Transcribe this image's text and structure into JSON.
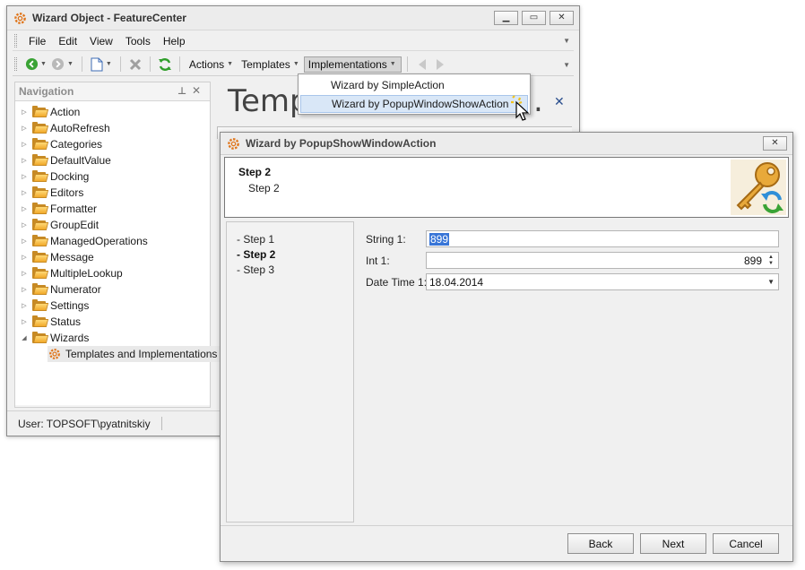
{
  "main_window": {
    "title": "Wizard Object - FeatureCenter",
    "caption_buttons": [
      "minimize",
      "maximize",
      "close"
    ]
  },
  "menubar": {
    "items": [
      "File",
      "Edit",
      "View",
      "Tools",
      "Help"
    ]
  },
  "toolbar": {
    "actions_label": "Actions",
    "templates_label": "Templates",
    "implementations_label": "Implementations"
  },
  "implementations_menu": {
    "items": [
      "Wizard by SimpleAction",
      "Wizard by PopupWindowShowAction"
    ],
    "highlighted_index": 1
  },
  "navigation": {
    "title": "Navigation",
    "items": [
      "Action",
      "AutoRefresh",
      "Categories",
      "DefaultValue",
      "Docking",
      "Editors",
      "Formatter",
      "GroupEdit",
      "ManagedOperations",
      "Message",
      "MultipleLookup",
      "Numerator",
      "Settings",
      "Status",
      "Wizards"
    ],
    "expanded_item": "Wizards",
    "child_item": "Templates and Implementations"
  },
  "main_view": {
    "title_partial": "Temp",
    "title_tail": "."
  },
  "status_bar": {
    "user": "User: TOPSOFT\\pyatnitskiy"
  },
  "wizard": {
    "title": "Wizard by PopupShowWindowAction",
    "header_title": "Step 2",
    "header_subtitle": "Step 2",
    "steps": [
      "- Step 1",
      "- Step 2",
      "- Step 3"
    ],
    "current_step_index": 1,
    "fields": {
      "string1_label": "String 1:",
      "string1_value": "899",
      "int1_label": "Int 1:",
      "int1_value": "899",
      "datetime1_label": "Date Time 1:",
      "datetime1_value": "18.04.2014"
    },
    "buttons": {
      "back": "Back",
      "next": "Next",
      "cancel": "Cancel"
    }
  },
  "colors": {
    "selection": "#3875d7",
    "folder": "#f1a92a",
    "menu_highlight": "#d9e7f7"
  }
}
